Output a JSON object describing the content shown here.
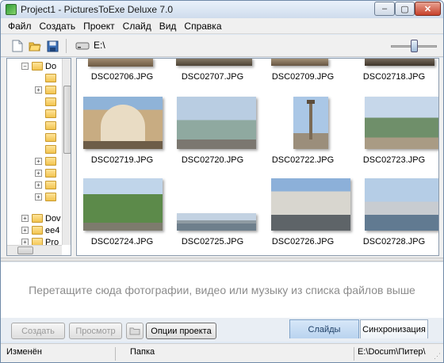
{
  "window": {
    "title": "Project1 - PicturesToExe Deluxe 7.0",
    "min_glyph": "‒",
    "max_glyph": "▢",
    "close_glyph": "✕"
  },
  "menu": [
    "Файл",
    "Создать",
    "Проект",
    "Слайд",
    "Вид",
    "Справка"
  ],
  "toolbar": {
    "path": "E:\\",
    "zoom_level": 0.55
  },
  "tree": {
    "rows": [
      "Do",
      "",
      "",
      "",
      "",
      "",
      "",
      "",
      "",
      "",
      "",
      "",
      "Dov",
      "ee4",
      "Pro"
    ]
  },
  "thumbnails": [
    {
      "file": "DSC02706.JPG"
    },
    {
      "file": "DSC02707.JPG"
    },
    {
      "file": "DSC02709.JPG"
    },
    {
      "file": "DSC02718.JPG"
    },
    {
      "file": "DSC02719.JPG"
    },
    {
      "file": "DSC02720.JPG"
    },
    {
      "file": "DSC02722.JPG"
    },
    {
      "file": "DSC02723.JPG"
    },
    {
      "file": "DSC02724.JPG"
    },
    {
      "file": "DSC02725.JPG"
    },
    {
      "file": "DSC02726.JPG"
    },
    {
      "file": "DSC02728.JPG"
    }
  ],
  "dropzone": {
    "hint": "Перетащите сюда фотографии, видео или музыку из списка файлов выше"
  },
  "buttons": {
    "create": "Создать",
    "preview": "Просмотр",
    "project_options": "Опции проекта"
  },
  "tabs": {
    "slides": "Слайды",
    "sync": "Синхронизация"
  },
  "status": {
    "modified": "Изменён",
    "folder": "Папка",
    "path": "E:\\Docum\\Питер\\"
  }
}
